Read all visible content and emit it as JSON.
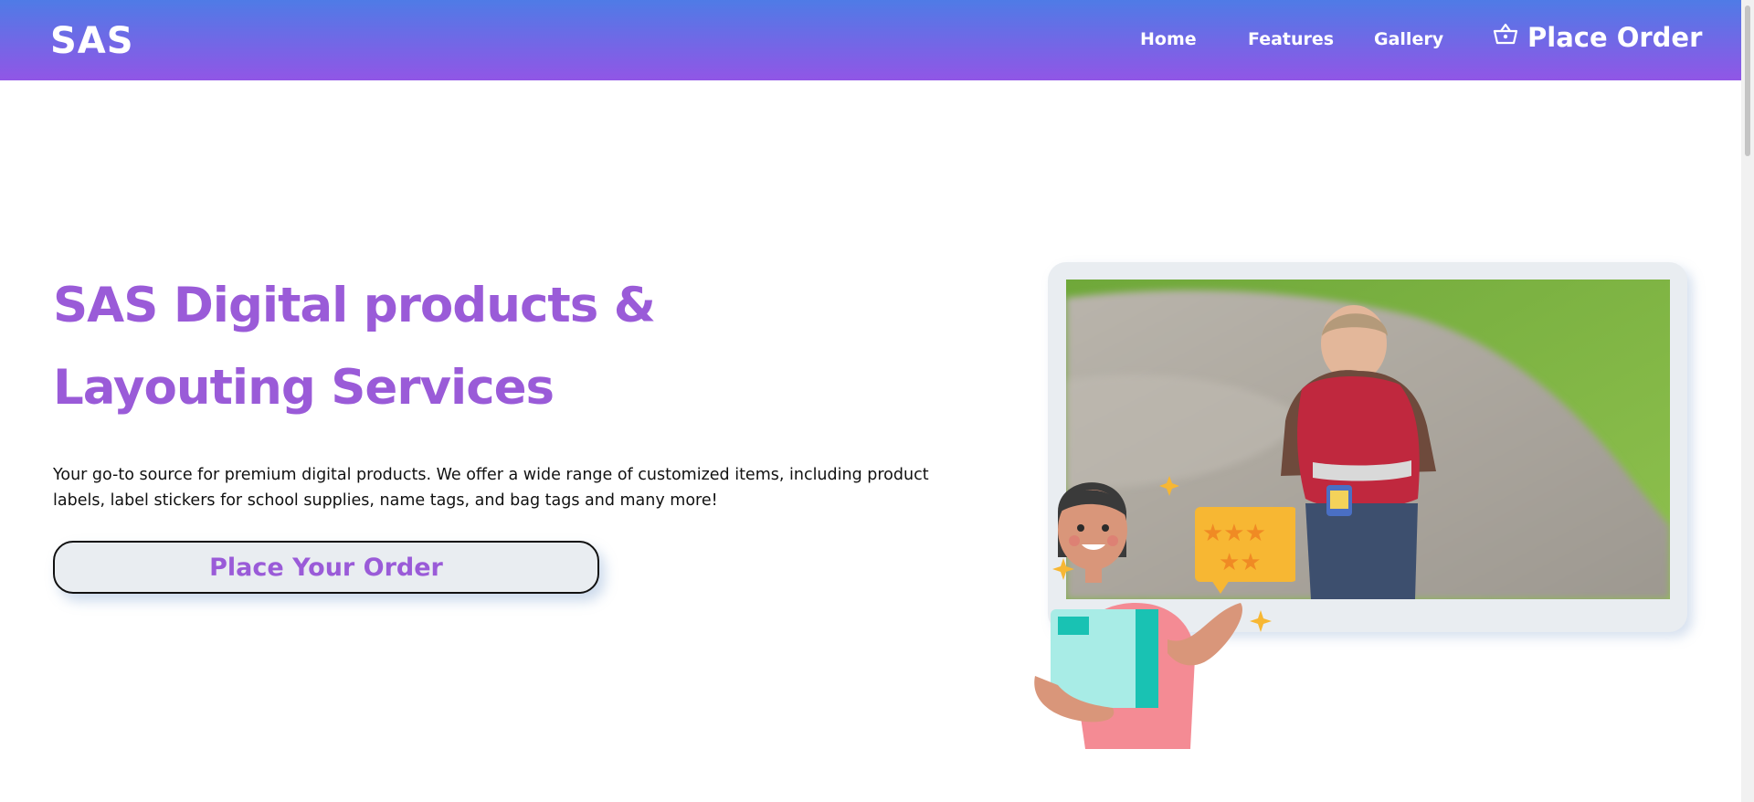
{
  "navbar": {
    "logo": "SAS",
    "links": [
      {
        "label": "Home"
      },
      {
        "label": "Features"
      },
      {
        "label": "Gallery"
      }
    ],
    "order_label": "Place Order",
    "order_icon": "basket-icon"
  },
  "hero": {
    "title_line1": "SAS Digital products &",
    "title_line2": "Layouting Services",
    "description": "Your go-to source for premium digital products. We offer a wide range of customized items, including product labels, label stickers for school supplies, name tags, and bag tags and many more!",
    "cta_label": "Place Your Order"
  },
  "colors": {
    "nav_gradient_top": "#4f7be6",
    "nav_gradient_bottom": "#9156e6",
    "accent_purple": "#9a5bd8",
    "button_bg": "#e9edf1"
  }
}
